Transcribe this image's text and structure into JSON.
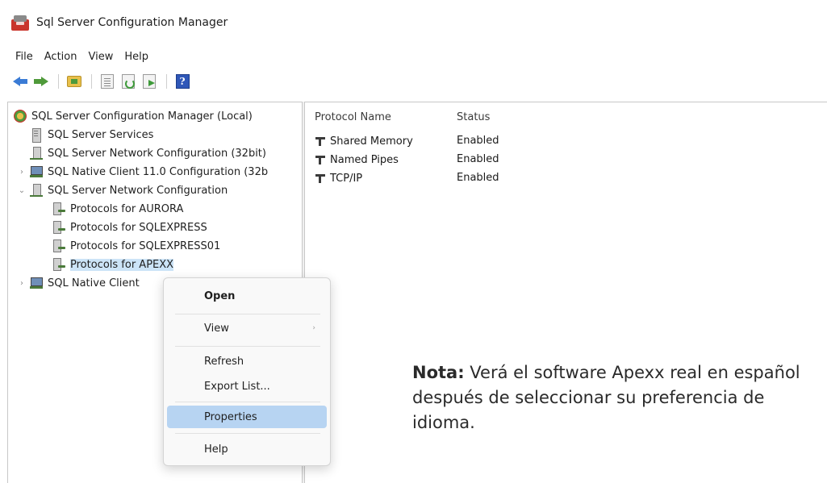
{
  "window": {
    "title": "Sql Server Configuration Manager"
  },
  "menu": [
    "File",
    "Action",
    "View",
    "Help"
  ],
  "toolbar": {
    "icons": [
      "back-arrow-icon",
      "forward-arrow-icon",
      "up-folder-icon",
      "show-hide-tree-icon",
      "refresh-icon",
      "export-list-icon",
      "help-icon"
    ],
    "help_glyph": "?"
  },
  "tree": {
    "root": "SQL Server Configuration Manager (Local)",
    "items": [
      "SQL Server Services",
      "SQL Server Network Configuration (32bit)",
      "SQL Native Client 11.0 Configuration (32b",
      "SQL Server Network Configuration",
      "Protocols for AURORA",
      "Protocols for SQLEXPRESS",
      "Protocols for SQLEXPRESS01",
      "Protocols for APEXX",
      "SQL Native Client"
    ],
    "expander_collapsed": "›",
    "expander_expanded": "⌄"
  },
  "list": {
    "columns": [
      "Protocol Name",
      "Status"
    ],
    "rows": [
      {
        "name": "Shared Memory",
        "status": "Enabled"
      },
      {
        "name": "Named Pipes",
        "status": "Enabled"
      },
      {
        "name": "TCP/IP",
        "status": "Enabled"
      }
    ]
  },
  "context_menu": {
    "items": [
      "Open",
      "View",
      "Refresh",
      "Export List...",
      "Properties",
      "Help"
    ],
    "submenu_glyph": "›"
  },
  "note": {
    "label": "Nota:",
    "text": " Verá el software Apexx real en español después de seleccionar su preferencia de idioma."
  },
  "colors": {
    "selection": "#cce4f7",
    "menu_highlight": "#b7d4f2",
    "help_icon": "#2f57b8"
  }
}
